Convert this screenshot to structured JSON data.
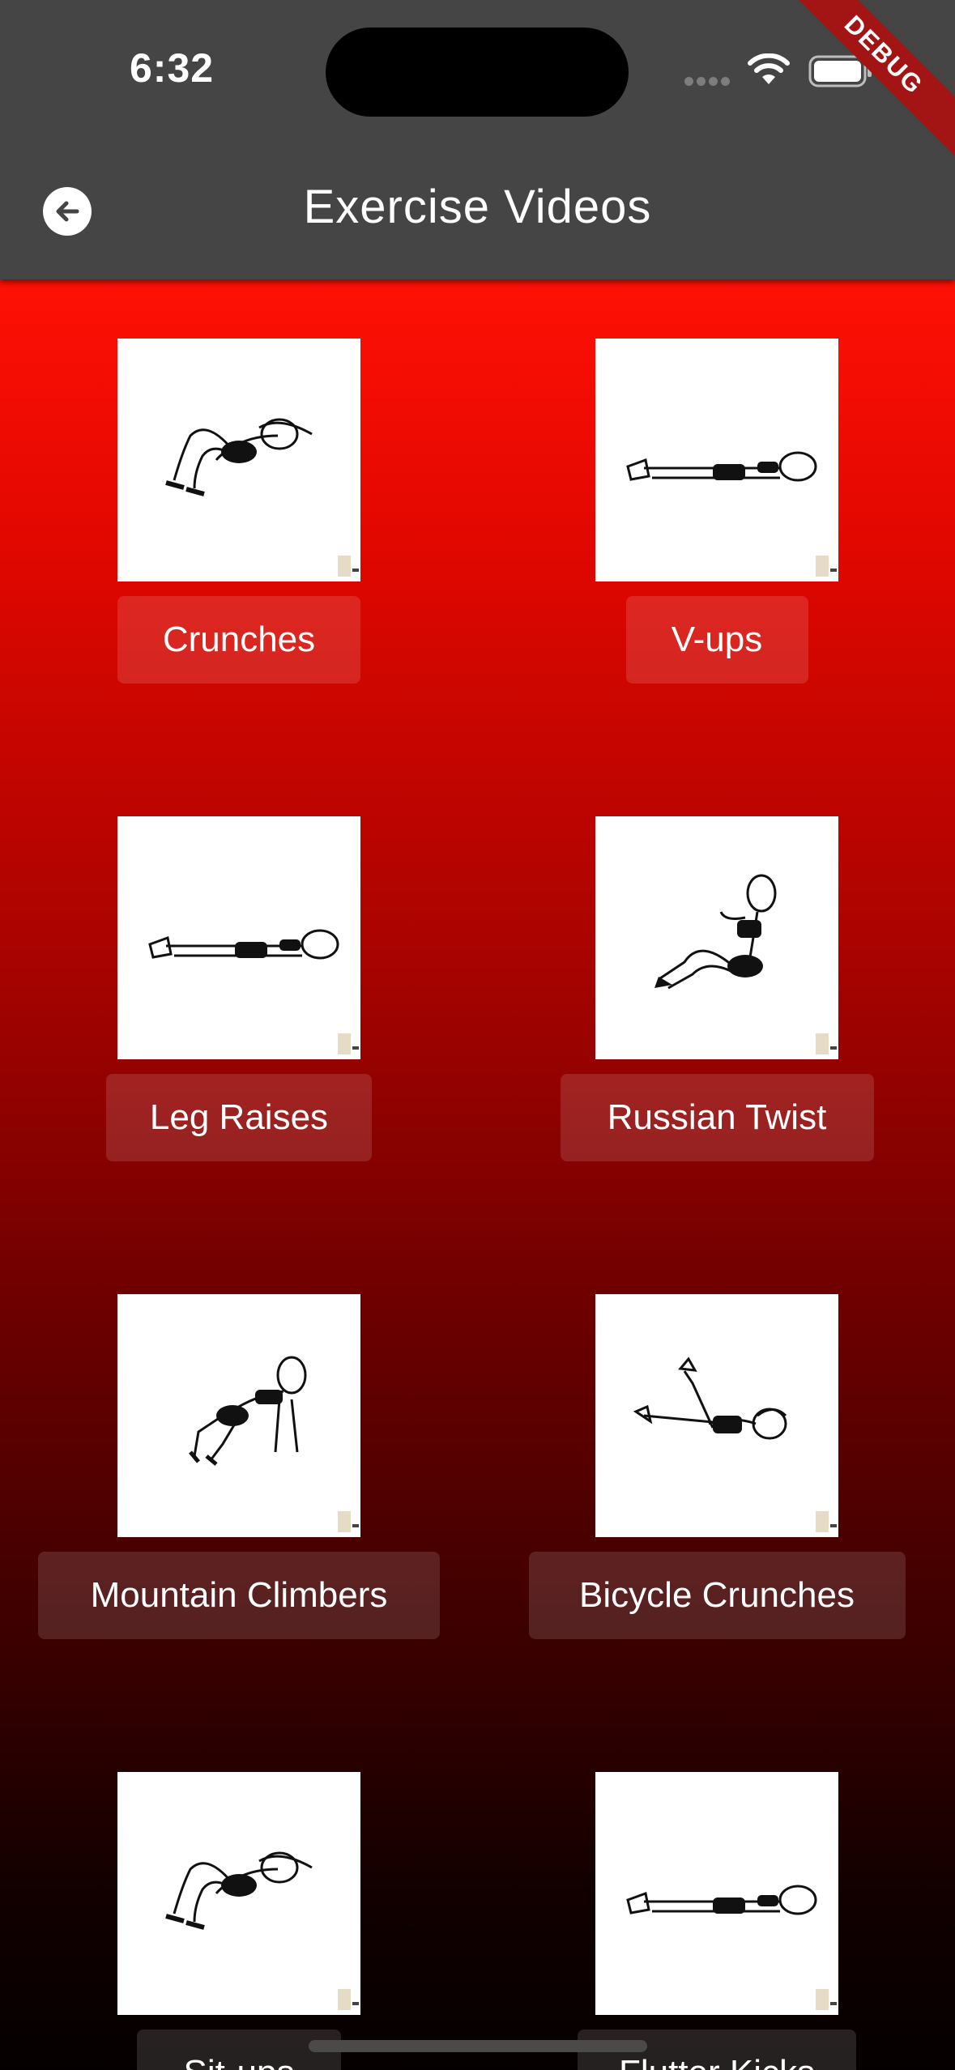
{
  "status_bar": {
    "time": "6:32"
  },
  "app_bar": {
    "title": "Exercise Videos",
    "back_icon": "arrow-back-icon"
  },
  "debug_banner": "DEBUG",
  "colors": {
    "appbar": "#454545",
    "gradient_top": "#ff1005",
    "gradient_bottom": "#050000",
    "debug": "#a31515"
  },
  "exercises": [
    {
      "name": "Crunches",
      "pose": "crunch"
    },
    {
      "name": "V-ups",
      "pose": "lying"
    },
    {
      "name": "Leg Raises",
      "pose": "lying"
    },
    {
      "name": "Russian Twist",
      "pose": "seated"
    },
    {
      "name": "Mountain Climbers",
      "pose": "plank"
    },
    {
      "name": "Bicycle Crunches",
      "pose": "bicycle"
    },
    {
      "name": "Sit-ups",
      "pose": "crunch"
    },
    {
      "name": "Flutter Kicks",
      "pose": "lying"
    }
  ]
}
